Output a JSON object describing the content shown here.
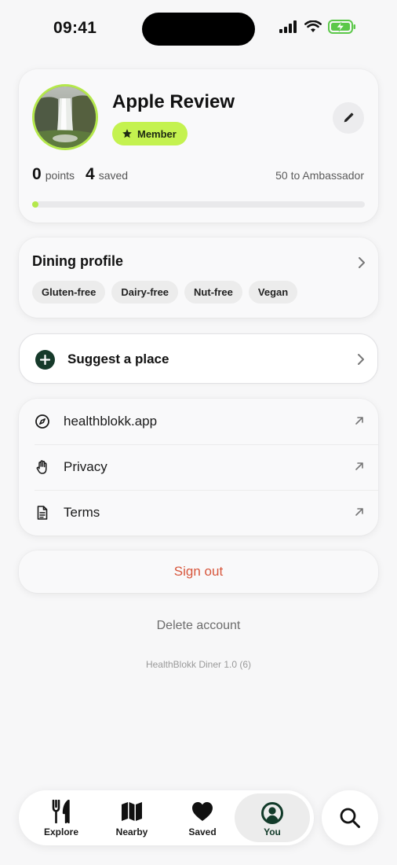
{
  "status_bar": {
    "time": "09:41"
  },
  "profile": {
    "name": "Apple Review",
    "badge": "Member",
    "points_value": "0",
    "points_label": "points",
    "saved_value": "4",
    "saved_label": "saved",
    "next_tier": "50 to Ambassador",
    "progress_fraction": 0.0
  },
  "dining_profile": {
    "title": "Dining profile",
    "tags": [
      "Gluten-free",
      "Dairy-free",
      "Nut-free",
      "Vegan"
    ]
  },
  "suggest": {
    "label": "Suggest a place"
  },
  "links": [
    {
      "label": "healthblokk.app",
      "icon": "compass-icon"
    },
    {
      "label": "Privacy",
      "icon": "hand-icon"
    },
    {
      "label": "Terms",
      "icon": "document-icon"
    }
  ],
  "sign_out": "Sign out",
  "delete_account": "Delete account",
  "version": "HealthBlokk Diner 1.0 (6)",
  "tabs": [
    {
      "label": "Explore",
      "icon": "fork-knife-icon"
    },
    {
      "label": "Nearby",
      "icon": "map-icon"
    },
    {
      "label": "Saved",
      "icon": "heart-icon"
    },
    {
      "label": "You",
      "icon": "person-icon",
      "active": true
    }
  ],
  "colors": {
    "accent_lime": "#c4f24f",
    "dark_green": "#163a2a",
    "danger": "#d7563c"
  }
}
